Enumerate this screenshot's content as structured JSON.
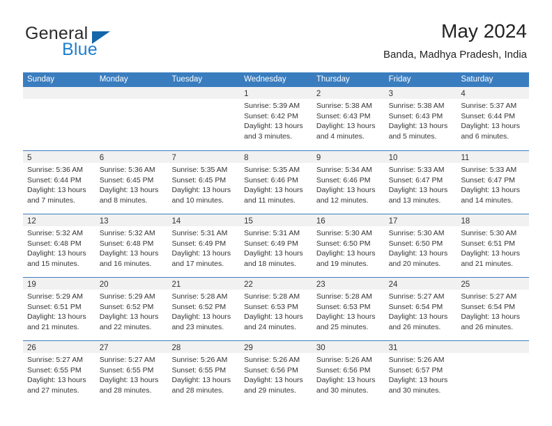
{
  "brand": {
    "name_part1": "General",
    "name_part2": "Blue",
    "accent_color": "#1f7fd0",
    "triangle_color": "#1466ab"
  },
  "header": {
    "month_title": "May 2024",
    "location": "Banda, Madhya Pradesh, India"
  },
  "calendar": {
    "header_bg": "#3a7dbf",
    "day_strip_bg": "#f1f1f1",
    "weekdays": [
      "Sunday",
      "Monday",
      "Tuesday",
      "Wednesday",
      "Thursday",
      "Friday",
      "Saturday"
    ],
    "weeks": [
      [
        {
          "day": "",
          "lines": []
        },
        {
          "day": "",
          "lines": []
        },
        {
          "day": "",
          "lines": []
        },
        {
          "day": "1",
          "lines": [
            "Sunrise: 5:39 AM",
            "Sunset: 6:42 PM",
            "Daylight: 13 hours",
            "and 3 minutes."
          ]
        },
        {
          "day": "2",
          "lines": [
            "Sunrise: 5:38 AM",
            "Sunset: 6:43 PM",
            "Daylight: 13 hours",
            "and 4 minutes."
          ]
        },
        {
          "day": "3",
          "lines": [
            "Sunrise: 5:38 AM",
            "Sunset: 6:43 PM",
            "Daylight: 13 hours",
            "and 5 minutes."
          ]
        },
        {
          "day": "4",
          "lines": [
            "Sunrise: 5:37 AM",
            "Sunset: 6:44 PM",
            "Daylight: 13 hours",
            "and 6 minutes."
          ]
        }
      ],
      [
        {
          "day": "5",
          "lines": [
            "Sunrise: 5:36 AM",
            "Sunset: 6:44 PM",
            "Daylight: 13 hours",
            "and 7 minutes."
          ]
        },
        {
          "day": "6",
          "lines": [
            "Sunrise: 5:36 AM",
            "Sunset: 6:45 PM",
            "Daylight: 13 hours",
            "and 8 minutes."
          ]
        },
        {
          "day": "7",
          "lines": [
            "Sunrise: 5:35 AM",
            "Sunset: 6:45 PM",
            "Daylight: 13 hours",
            "and 10 minutes."
          ]
        },
        {
          "day": "8",
          "lines": [
            "Sunrise: 5:35 AM",
            "Sunset: 6:46 PM",
            "Daylight: 13 hours",
            "and 11 minutes."
          ]
        },
        {
          "day": "9",
          "lines": [
            "Sunrise: 5:34 AM",
            "Sunset: 6:46 PM",
            "Daylight: 13 hours",
            "and 12 minutes."
          ]
        },
        {
          "day": "10",
          "lines": [
            "Sunrise: 5:33 AM",
            "Sunset: 6:47 PM",
            "Daylight: 13 hours",
            "and 13 minutes."
          ]
        },
        {
          "day": "11",
          "lines": [
            "Sunrise: 5:33 AM",
            "Sunset: 6:47 PM",
            "Daylight: 13 hours",
            "and 14 minutes."
          ]
        }
      ],
      [
        {
          "day": "12",
          "lines": [
            "Sunrise: 5:32 AM",
            "Sunset: 6:48 PM",
            "Daylight: 13 hours",
            "and 15 minutes."
          ]
        },
        {
          "day": "13",
          "lines": [
            "Sunrise: 5:32 AM",
            "Sunset: 6:48 PM",
            "Daylight: 13 hours",
            "and 16 minutes."
          ]
        },
        {
          "day": "14",
          "lines": [
            "Sunrise: 5:31 AM",
            "Sunset: 6:49 PM",
            "Daylight: 13 hours",
            "and 17 minutes."
          ]
        },
        {
          "day": "15",
          "lines": [
            "Sunrise: 5:31 AM",
            "Sunset: 6:49 PM",
            "Daylight: 13 hours",
            "and 18 minutes."
          ]
        },
        {
          "day": "16",
          "lines": [
            "Sunrise: 5:30 AM",
            "Sunset: 6:50 PM",
            "Daylight: 13 hours",
            "and 19 minutes."
          ]
        },
        {
          "day": "17",
          "lines": [
            "Sunrise: 5:30 AM",
            "Sunset: 6:50 PM",
            "Daylight: 13 hours",
            "and 20 minutes."
          ]
        },
        {
          "day": "18",
          "lines": [
            "Sunrise: 5:30 AM",
            "Sunset: 6:51 PM",
            "Daylight: 13 hours",
            "and 21 minutes."
          ]
        }
      ],
      [
        {
          "day": "19",
          "lines": [
            "Sunrise: 5:29 AM",
            "Sunset: 6:51 PM",
            "Daylight: 13 hours",
            "and 21 minutes."
          ]
        },
        {
          "day": "20",
          "lines": [
            "Sunrise: 5:29 AM",
            "Sunset: 6:52 PM",
            "Daylight: 13 hours",
            "and 22 minutes."
          ]
        },
        {
          "day": "21",
          "lines": [
            "Sunrise: 5:28 AM",
            "Sunset: 6:52 PM",
            "Daylight: 13 hours",
            "and 23 minutes."
          ]
        },
        {
          "day": "22",
          "lines": [
            "Sunrise: 5:28 AM",
            "Sunset: 6:53 PM",
            "Daylight: 13 hours",
            "and 24 minutes."
          ]
        },
        {
          "day": "23",
          "lines": [
            "Sunrise: 5:28 AM",
            "Sunset: 6:53 PM",
            "Daylight: 13 hours",
            "and 25 minutes."
          ]
        },
        {
          "day": "24",
          "lines": [
            "Sunrise: 5:27 AM",
            "Sunset: 6:54 PM",
            "Daylight: 13 hours",
            "and 26 minutes."
          ]
        },
        {
          "day": "25",
          "lines": [
            "Sunrise: 5:27 AM",
            "Sunset: 6:54 PM",
            "Daylight: 13 hours",
            "and 26 minutes."
          ]
        }
      ],
      [
        {
          "day": "26",
          "lines": [
            "Sunrise: 5:27 AM",
            "Sunset: 6:55 PM",
            "Daylight: 13 hours",
            "and 27 minutes."
          ]
        },
        {
          "day": "27",
          "lines": [
            "Sunrise: 5:27 AM",
            "Sunset: 6:55 PM",
            "Daylight: 13 hours",
            "and 28 minutes."
          ]
        },
        {
          "day": "28",
          "lines": [
            "Sunrise: 5:26 AM",
            "Sunset: 6:55 PM",
            "Daylight: 13 hours",
            "and 28 minutes."
          ]
        },
        {
          "day": "29",
          "lines": [
            "Sunrise: 5:26 AM",
            "Sunset: 6:56 PM",
            "Daylight: 13 hours",
            "and 29 minutes."
          ]
        },
        {
          "day": "30",
          "lines": [
            "Sunrise: 5:26 AM",
            "Sunset: 6:56 PM",
            "Daylight: 13 hours",
            "and 30 minutes."
          ]
        },
        {
          "day": "31",
          "lines": [
            "Sunrise: 5:26 AM",
            "Sunset: 6:57 PM",
            "Daylight: 13 hours",
            "and 30 minutes."
          ]
        },
        {
          "day": "",
          "lines": []
        }
      ]
    ]
  }
}
